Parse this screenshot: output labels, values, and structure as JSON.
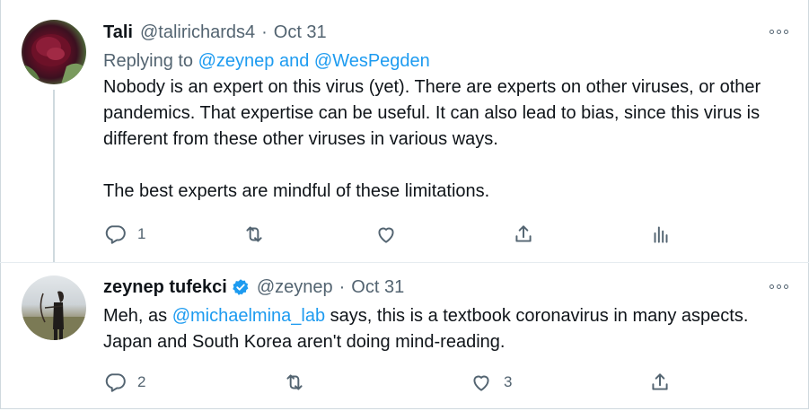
{
  "tweets": [
    {
      "display_name": "Tali",
      "handle": "@talirichards4",
      "separator": "·",
      "date": "Oct 31",
      "replying_prefix": "Replying to",
      "replying_to": "@zeynep and @WesPegden",
      "paragraph1": "Nobody is an expert on this virus (yet). There are experts on other viruses, or other pandemics. That expertise can be useful. It can also lead to bias, since this virus is different from these other viruses in various ways.",
      "paragraph2": "The best experts are mindful of these limitations.",
      "reply_count": "1",
      "retweet_count": "",
      "like_count": ""
    },
    {
      "display_name": "zeynep tufekci",
      "verified": true,
      "handle": "@zeynep",
      "separator": "·",
      "date": "Oct 31",
      "text_before": "Meh, as ",
      "mention": "@michaelmina_lab",
      "text_after": " says, this is a textbook coronavirus in many aspects. Japan and South Korea aren't doing mind-reading.",
      "reply_count": "2",
      "retweet_count": "",
      "like_count": "3"
    }
  ],
  "icons": {
    "reply": "reply-icon",
    "retweet": "retweet-icon",
    "like": "heart-icon",
    "share": "share-icon",
    "analytics": "analytics-icon",
    "more": "more-options-icon",
    "verified": "verified-badge-icon"
  },
  "colors": {
    "text": "#0f1419",
    "secondary": "#536471",
    "link": "#1d9bf0",
    "border": "#cfd9de"
  }
}
